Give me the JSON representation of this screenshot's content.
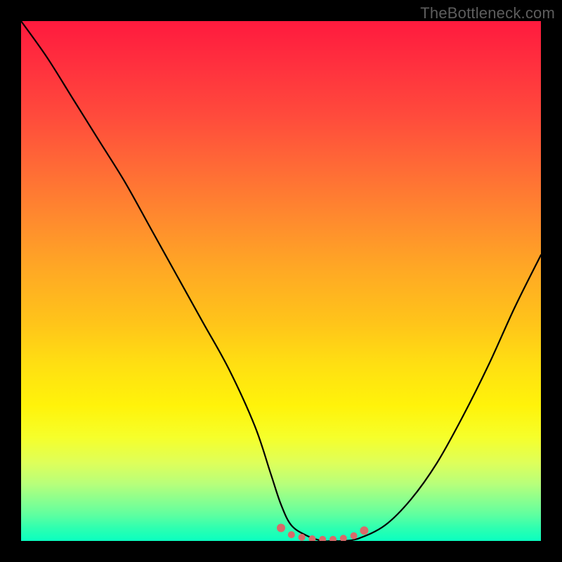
{
  "watermark": "TheBottleneck.com",
  "colors": {
    "frame": "#000000",
    "gradient_top": "#ff1a3e",
    "gradient_bottom": "#0affc0",
    "curve": "#000000",
    "accent_points": "#d86a6a"
  },
  "chart_data": {
    "type": "line",
    "title": "",
    "xlabel": "",
    "ylabel": "",
    "xlim": [
      0,
      100
    ],
    "ylim": [
      0,
      100
    ],
    "grid": false,
    "legend": false,
    "series": [
      {
        "name": "curve",
        "x": [
          0,
          5,
          10,
          15,
          20,
          25,
          30,
          35,
          40,
          45,
          48,
          50,
          52,
          55,
          58,
          60,
          62,
          65,
          70,
          75,
          80,
          85,
          90,
          95,
          100
        ],
        "y": [
          100,
          93,
          85,
          77,
          69,
          60,
          51,
          42,
          33,
          22,
          13,
          7,
          3,
          1,
          0,
          0,
          0,
          0.5,
          3,
          8,
          15,
          24,
          34,
          45,
          55
        ]
      }
    ],
    "accent_region": {
      "name": "flat-bottom-dots",
      "x": [
        50,
        52,
        54,
        56,
        58,
        60,
        62,
        64,
        66
      ],
      "y": [
        2.5,
        1.2,
        0.7,
        0.4,
        0.3,
        0.3,
        0.5,
        1.0,
        2.0
      ]
    }
  }
}
